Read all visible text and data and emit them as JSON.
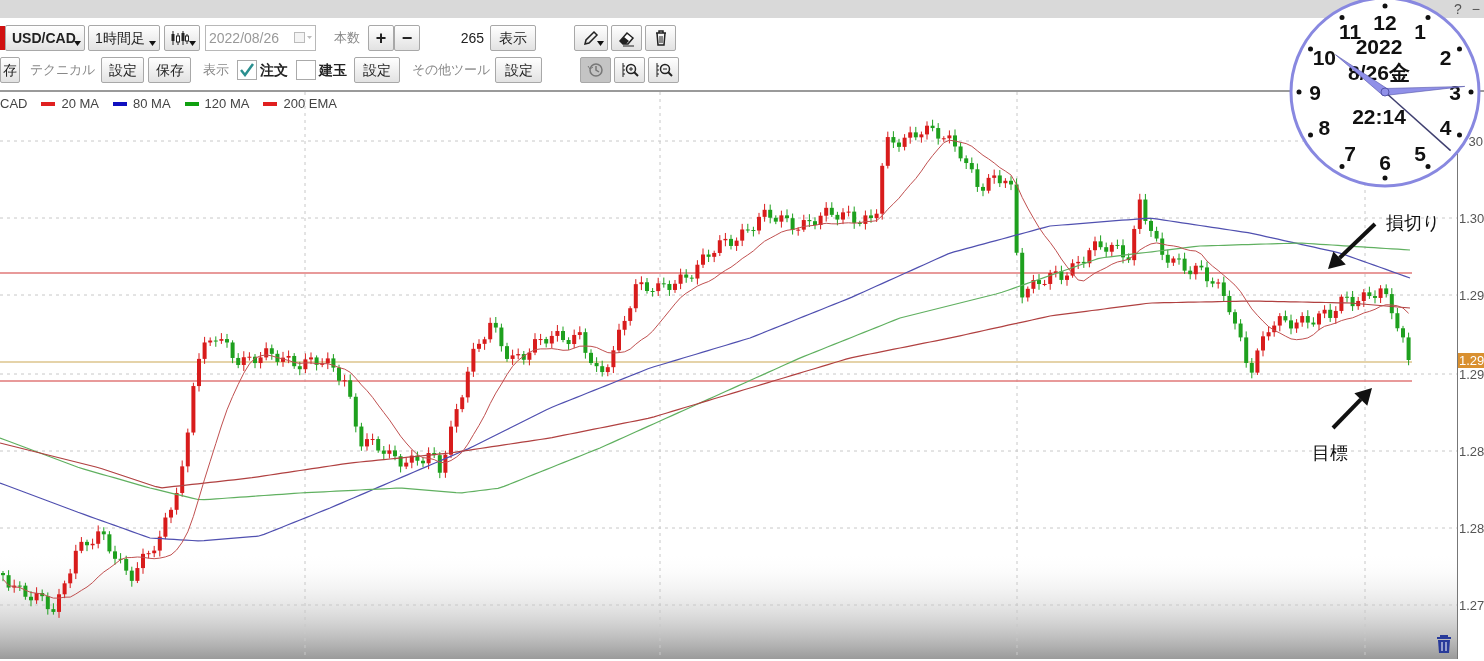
{
  "window_controls": [
    "?",
    "−"
  ],
  "toolbar": {
    "symbol": "USD/CAD",
    "timeframe": "1時間足",
    "date_field": {
      "value": "2022/08/26",
      "disabled": true
    },
    "bar_count_label": "本数",
    "plus": "+",
    "minus": "−",
    "bar_count": "265",
    "show_button": "表示",
    "cut_button": "存",
    "technical_label": "テクニカル",
    "technical_buttons": [
      "設定",
      "保存"
    ],
    "display_label": "表示",
    "checkboxes": [
      {
        "label": "注文",
        "checked": true
      },
      {
        "label": "建玉",
        "checked": false
      }
    ],
    "display_button": "設定",
    "other_tools_label": "その他ツール",
    "other_tools_button": "設定"
  },
  "drawing_tools": [
    {
      "kind": "pen",
      "active": false
    },
    {
      "kind": "eraser",
      "active": false
    },
    {
      "kind": "trash",
      "active": false
    },
    {
      "kind": "history",
      "active": true
    },
    {
      "kind": "zoom_in",
      "active": false
    },
    {
      "kind": "zoom_out",
      "active": false
    }
  ],
  "legend": {
    "symbol": "CAD",
    "items": [
      {
        "label": "20 MA",
        "color": "#e02020"
      },
      {
        "label": "80 MA",
        "color": "#1010c0"
      },
      {
        "label": "120 MA",
        "color": "#10a010"
      },
      {
        "label": "200 EMA",
        "color": "#e02020"
      }
    ]
  },
  "price_axis": [
    {
      "text": "30",
      "kind": "tick"
    },
    {
      "text": "1.30",
      "kind": "tick"
    },
    {
      "text": "1.29",
      "kind": "tick"
    },
    {
      "text": "1.29",
      "kind": "current"
    },
    {
      "text": "1.29",
      "kind": "tick"
    },
    {
      "text": "1.28",
      "kind": "tick"
    },
    {
      "text": "1.28",
      "kind": "tick"
    },
    {
      "text": "1.27",
      "kind": "tick"
    }
  ],
  "annotations": [
    {
      "text": "損切り"
    },
    {
      "text": "目標"
    }
  ],
  "clock": {
    "year": "2022",
    "date": "8/26金",
    "time": "22:14",
    "numerals": [
      "12",
      "11",
      "1",
      "10",
      "2",
      "9",
      "3",
      "8",
      "4",
      "7",
      "5",
      "6"
    ]
  }
}
